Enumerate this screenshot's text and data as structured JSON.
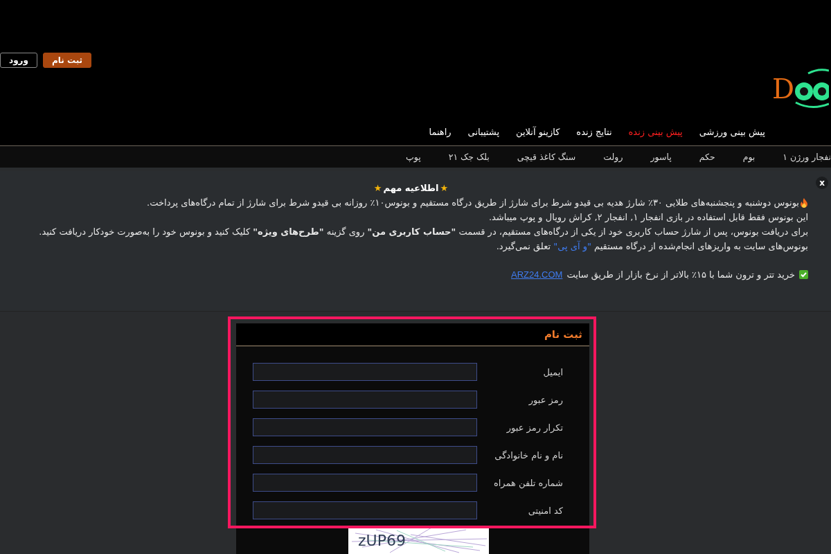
{
  "header": {
    "buttons": [
      {
        "label": "ثبت نام",
        "kind": "primary"
      },
      {
        "label": "ورود",
        "kind": "outline"
      }
    ],
    "logo": {
      "text": "D"
    }
  },
  "nav": [
    {
      "label": "پیش بینی ورزشی",
      "selected": false
    },
    {
      "label": "پیش بینی زنده",
      "selected": true
    },
    {
      "label": "نتایج زنده",
      "selected": false
    },
    {
      "label": "کازینو آنلاین",
      "selected": false
    },
    {
      "label": "پشتیبانی",
      "selected": false
    },
    {
      "label": "راهنما",
      "selected": false
    }
  ],
  "games": [
    "نفجار ورژن ۱",
    "بوم",
    "حکم",
    "پاسور",
    "رولت",
    "سنگ کاغذ قیچی",
    "بلک جک ۲۱",
    "پوپ"
  ],
  "notice": {
    "close": "x",
    "star": "★",
    "title": "اطلاعیه مهم",
    "lines": [
      {
        "kind": "fire",
        "text": "بونوس دوشنبه و پنجشنبه‌های طلایی ۳۰٪ شارژ هدیه بی قیدو شرط برای شارژ از طریق درگاه مستقیم و بونوس۱۰٪ روزانه بی قیدو شرط برای شارژ از تمام درگاه‌های پرداخت."
      },
      {
        "kind": "plain",
        "text": "این بونوس فقط قابل استفاده در بازی انفجار ۱, انفجار ۲, کراش رویال و پوپ میباشد."
      },
      {
        "kind": "plain",
        "text": "برای دریافت بونوس، پس از شارژ حساب کاربری خود از یکی از درگاه‌های مستقیم، در قسمت **\"حساب کاربری من\"** روی گزینه **\"طرح‌های ویژه\"** کلیک کنید و بونوس خود را به‌صورت خودکار دریافت کنید."
      },
      {
        "kind": "link",
        "text": "بونوس‌های سایت به واریزهای انجام‌شده از درگاه مستقیم",
        "link": "\"و آی پی\"",
        "after": "تعلق نمی‌گیرد."
      }
    ],
    "promo": {
      "text": "خرید تتر و ترون شما با ۱۵٪ بالاتر از نرخ بازار از طریق سایت",
      "link": "ARZ24.COM"
    }
  },
  "form": {
    "title": "ثبت نام",
    "highlighted": true,
    "fields": [
      {
        "label": "ایمیل"
      },
      {
        "label": "رمز عبور"
      },
      {
        "label": "تکرار رمز عبور"
      },
      {
        "label": "نام و نام خانوادگی"
      },
      {
        "label": "شماره تلفن همراه"
      },
      {
        "label": "کد امنیتی"
      }
    ],
    "captcha": "zUP69"
  }
}
